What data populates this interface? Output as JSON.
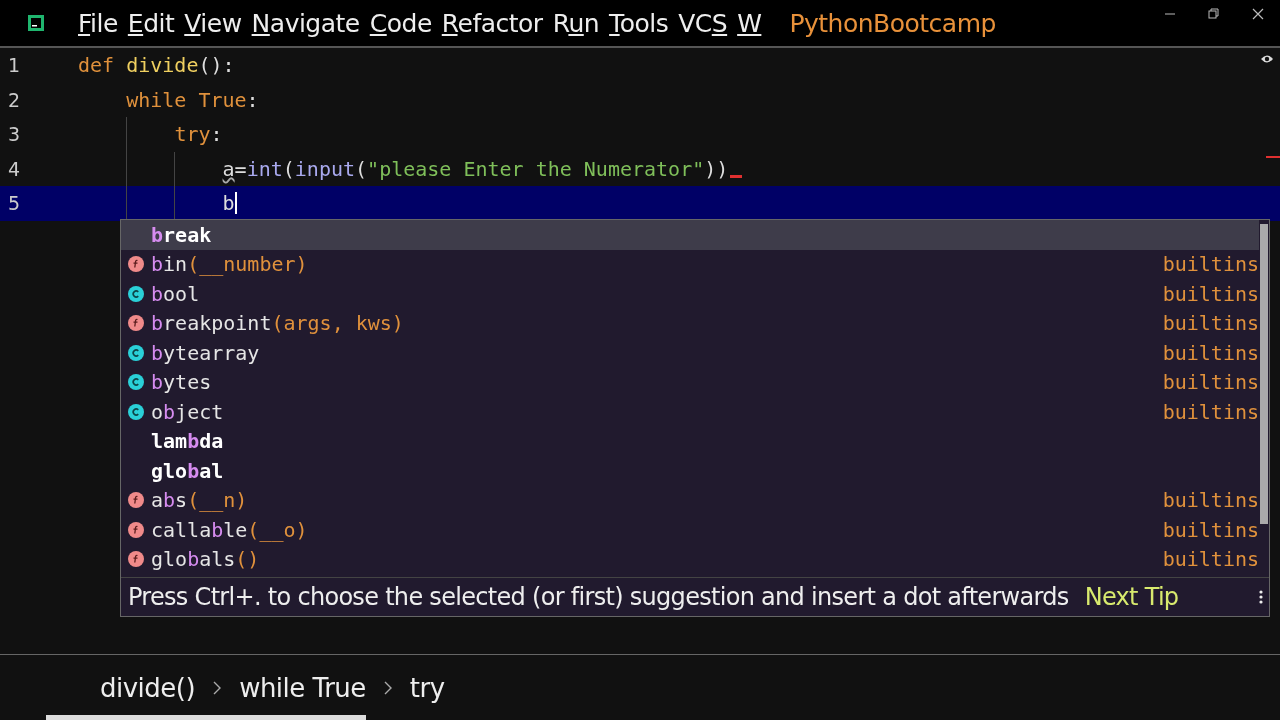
{
  "window": {
    "menu": [
      {
        "key": "F",
        "post": "ile"
      },
      {
        "key": "E",
        "post": "dit"
      },
      {
        "key": "V",
        "post": "iew"
      },
      {
        "key": "N",
        "post": "avigate"
      },
      {
        "key": "C",
        "post": "ode"
      },
      {
        "key": "R",
        "post": "efactor"
      },
      {
        "pre": "R",
        "key": "u",
        "post": "n"
      },
      {
        "key": "T",
        "post": "ools"
      },
      {
        "pre": "VC",
        "key": "S"
      },
      {
        "key": "W"
      }
    ],
    "project": "PythonBootcamp"
  },
  "editor": {
    "lines": [
      {
        "number": "1",
        "current": false,
        "error": false,
        "tokens": [
          {
            "kind": "keyword",
            "text": "def "
          },
          {
            "kind": "function",
            "text": "divide"
          },
          {
            "kind": "plain",
            "text": "():"
          }
        ],
        "children": [
          {
            "number": "2",
            "current": false,
            "error": false,
            "tokens": [
              {
                "kind": "keyword",
                "text": "while "
              },
              {
                "kind": "keyword",
                "text": "True"
              },
              {
                "kind": "plain",
                "text": ":"
              }
            ],
            "children": [
              {
                "number": "3",
                "current": false,
                "error": false,
                "tokens": [
                  {
                    "kind": "keyword",
                    "text": "try"
                  },
                  {
                    "kind": "plain",
                    "text": ":"
                  }
                ],
                "children": [
                  {
                    "number": "4",
                    "current": false,
                    "error": true,
                    "tokens": [
                      {
                        "kind": "warning",
                        "text": "a"
                      },
                      {
                        "kind": "plain",
                        "text": "="
                      },
                      {
                        "kind": "builtin",
                        "text": "int"
                      },
                      {
                        "kind": "plain",
                        "text": "("
                      },
                      {
                        "kind": "builtin",
                        "text": "input"
                      },
                      {
                        "kind": "plain",
                        "text": "("
                      },
                      {
                        "kind": "string",
                        "text": "\"please Enter the Numerator\""
                      },
                      {
                        "kind": "plain",
                        "text": "))"
                      }
                    ]
                  },
                  {
                    "number": "5",
                    "current": true,
                    "error": false,
                    "tokens": [
                      {
                        "kind": "plain",
                        "text": "b"
                      }
                    ]
                  }
                ]
              }
            ]
          }
        ]
      }
    ]
  },
  "completion": {
    "items": [
      {
        "kind": "keyword",
        "selected": true,
        "match": "b",
        "suffix": "reak"
      },
      {
        "kind": "function",
        "selected": false,
        "match": "b",
        "suffix": "in",
        "params": "(__number)",
        "source": "builtins"
      },
      {
        "kind": "class",
        "selected": false,
        "match": "b",
        "suffix": "ool",
        "source": "builtins"
      },
      {
        "kind": "function",
        "selected": false,
        "match": "b",
        "suffix": "reakpoint",
        "params": "(args, kws)",
        "source": "builtins"
      },
      {
        "kind": "class",
        "selected": false,
        "match": "b",
        "suffix": "ytearray",
        "source": "builtins"
      },
      {
        "kind": "class",
        "selected": false,
        "match": "b",
        "suffix": "ytes",
        "source": "builtins"
      },
      {
        "kind": "class",
        "selected": false,
        "prefix": "o",
        "match": "b",
        "suffix": "ject",
        "source": "builtins"
      },
      {
        "kind": "keyword",
        "selected": false,
        "prefix": "lam",
        "match": "b",
        "suffix": "da"
      },
      {
        "kind": "keyword",
        "selected": false,
        "prefix": "glo",
        "match": "b",
        "suffix": "al"
      },
      {
        "kind": "function",
        "selected": false,
        "prefix": "a",
        "match": "b",
        "suffix": "s",
        "params": "(__n)",
        "source": "builtins"
      },
      {
        "kind": "function",
        "selected": false,
        "prefix": "calla",
        "match": "b",
        "suffix": "le",
        "params": "(__o)",
        "source": "builtins"
      },
      {
        "kind": "function",
        "selected": false,
        "prefix": "glo",
        "match": "b",
        "suffix": "als",
        "params": "()",
        "source": "builtins"
      }
    ],
    "tip": "Press Ctrl+. to choose the selected (or first) suggestion and insert a dot afterwards",
    "next_tip": "Next Tip"
  },
  "breadcrumbs": [
    "divide()",
    "while True",
    "try"
  ]
}
